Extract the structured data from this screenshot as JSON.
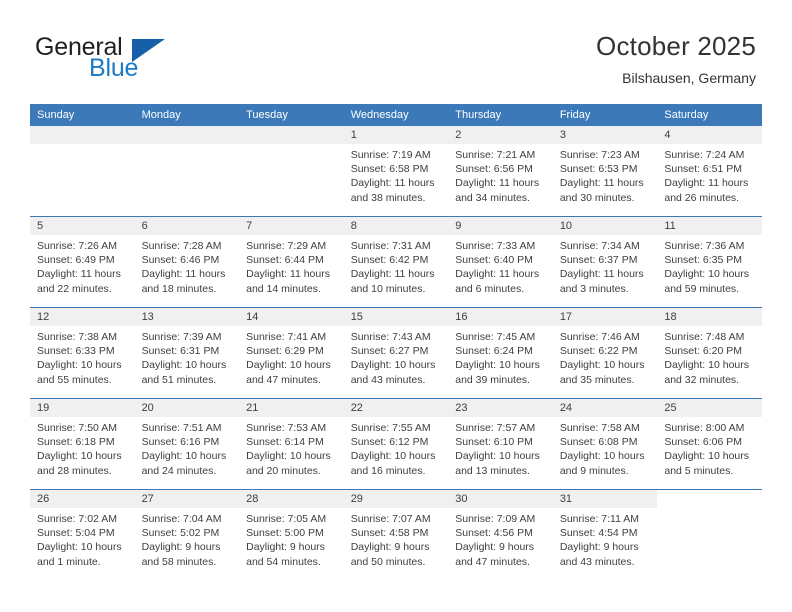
{
  "brand": {
    "name_primary": "General",
    "name_secondary": "Blue",
    "logo_icon": "triangle-logo-icon",
    "primary_color": "#231f20",
    "secondary_color": "#1b7ac4"
  },
  "header": {
    "title": "October 2025",
    "subtitle": "Bilshausen, Germany"
  },
  "theme": {
    "header_bg": "#3b79b8",
    "header_text": "#ffffff",
    "daynum_bg": "#f0f0f0",
    "body_text": "#3f3f3f",
    "page_bg": "#ffffff"
  },
  "weekdays": [
    "Sunday",
    "Monday",
    "Tuesday",
    "Wednesday",
    "Thursday",
    "Friday",
    "Saturday"
  ],
  "labels": {
    "sunrise_prefix": "Sunrise:",
    "sunset_prefix": "Sunset:",
    "daylight_prefix": "Daylight:"
  },
  "weeks": [
    [
      {
        "day": "",
        "empty": true,
        "blank": false,
        "line1": "",
        "line2": "",
        "line3": "",
        "line4": ""
      },
      {
        "day": "",
        "empty": true,
        "blank": false,
        "line1": "",
        "line2": "",
        "line3": "",
        "line4": ""
      },
      {
        "day": "",
        "empty": true,
        "blank": false,
        "line1": "",
        "line2": "",
        "line3": "",
        "line4": ""
      },
      {
        "day": "1",
        "empty": false,
        "blank": false,
        "line1": "Sunrise: 7:19 AM",
        "line2": "Sunset: 6:58 PM",
        "line3": "Daylight: 11 hours",
        "line4": "and 38 minutes."
      },
      {
        "day": "2",
        "empty": false,
        "blank": false,
        "line1": "Sunrise: 7:21 AM",
        "line2": "Sunset: 6:56 PM",
        "line3": "Daylight: 11 hours",
        "line4": "and 34 minutes."
      },
      {
        "day": "3",
        "empty": false,
        "blank": false,
        "line1": "Sunrise: 7:23 AM",
        "line2": "Sunset: 6:53 PM",
        "line3": "Daylight: 11 hours",
        "line4": "and 30 minutes."
      },
      {
        "day": "4",
        "empty": false,
        "blank": false,
        "line1": "Sunrise: 7:24 AM",
        "line2": "Sunset: 6:51 PM",
        "line3": "Daylight: 11 hours",
        "line4": "and 26 minutes."
      }
    ],
    [
      {
        "day": "5",
        "empty": false,
        "blank": false,
        "line1": "Sunrise: 7:26 AM",
        "line2": "Sunset: 6:49 PM",
        "line3": "Daylight: 11 hours",
        "line4": "and 22 minutes."
      },
      {
        "day": "6",
        "empty": false,
        "blank": false,
        "line1": "Sunrise: 7:28 AM",
        "line2": "Sunset: 6:46 PM",
        "line3": "Daylight: 11 hours",
        "line4": "and 18 minutes."
      },
      {
        "day": "7",
        "empty": false,
        "blank": false,
        "line1": "Sunrise: 7:29 AM",
        "line2": "Sunset: 6:44 PM",
        "line3": "Daylight: 11 hours",
        "line4": "and 14 minutes."
      },
      {
        "day": "8",
        "empty": false,
        "blank": false,
        "line1": "Sunrise: 7:31 AM",
        "line2": "Sunset: 6:42 PM",
        "line3": "Daylight: 11 hours",
        "line4": "and 10 minutes."
      },
      {
        "day": "9",
        "empty": false,
        "blank": false,
        "line1": "Sunrise: 7:33 AM",
        "line2": "Sunset: 6:40 PM",
        "line3": "Daylight: 11 hours",
        "line4": "and 6 minutes."
      },
      {
        "day": "10",
        "empty": false,
        "blank": false,
        "line1": "Sunrise: 7:34 AM",
        "line2": "Sunset: 6:37 PM",
        "line3": "Daylight: 11 hours",
        "line4": "and 3 minutes."
      },
      {
        "day": "11",
        "empty": false,
        "blank": false,
        "line1": "Sunrise: 7:36 AM",
        "line2": "Sunset: 6:35 PM",
        "line3": "Daylight: 10 hours",
        "line4": "and 59 minutes."
      }
    ],
    [
      {
        "day": "12",
        "empty": false,
        "blank": false,
        "line1": "Sunrise: 7:38 AM",
        "line2": "Sunset: 6:33 PM",
        "line3": "Daylight: 10 hours",
        "line4": "and 55 minutes."
      },
      {
        "day": "13",
        "empty": false,
        "blank": false,
        "line1": "Sunrise: 7:39 AM",
        "line2": "Sunset: 6:31 PM",
        "line3": "Daylight: 10 hours",
        "line4": "and 51 minutes."
      },
      {
        "day": "14",
        "empty": false,
        "blank": false,
        "line1": "Sunrise: 7:41 AM",
        "line2": "Sunset: 6:29 PM",
        "line3": "Daylight: 10 hours",
        "line4": "and 47 minutes."
      },
      {
        "day": "15",
        "empty": false,
        "blank": false,
        "line1": "Sunrise: 7:43 AM",
        "line2": "Sunset: 6:27 PM",
        "line3": "Daylight: 10 hours",
        "line4": "and 43 minutes."
      },
      {
        "day": "16",
        "empty": false,
        "blank": false,
        "line1": "Sunrise: 7:45 AM",
        "line2": "Sunset: 6:24 PM",
        "line3": "Daylight: 10 hours",
        "line4": "and 39 minutes."
      },
      {
        "day": "17",
        "empty": false,
        "blank": false,
        "line1": "Sunrise: 7:46 AM",
        "line2": "Sunset: 6:22 PM",
        "line3": "Daylight: 10 hours",
        "line4": "and 35 minutes."
      },
      {
        "day": "18",
        "empty": false,
        "blank": false,
        "line1": "Sunrise: 7:48 AM",
        "line2": "Sunset: 6:20 PM",
        "line3": "Daylight: 10 hours",
        "line4": "and 32 minutes."
      }
    ],
    [
      {
        "day": "19",
        "empty": false,
        "blank": false,
        "line1": "Sunrise: 7:50 AM",
        "line2": "Sunset: 6:18 PM",
        "line3": "Daylight: 10 hours",
        "line4": "and 28 minutes."
      },
      {
        "day": "20",
        "empty": false,
        "blank": false,
        "line1": "Sunrise: 7:51 AM",
        "line2": "Sunset: 6:16 PM",
        "line3": "Daylight: 10 hours",
        "line4": "and 24 minutes."
      },
      {
        "day": "21",
        "empty": false,
        "blank": false,
        "line1": "Sunrise: 7:53 AM",
        "line2": "Sunset: 6:14 PM",
        "line3": "Daylight: 10 hours",
        "line4": "and 20 minutes."
      },
      {
        "day": "22",
        "empty": false,
        "blank": false,
        "line1": "Sunrise: 7:55 AM",
        "line2": "Sunset: 6:12 PM",
        "line3": "Daylight: 10 hours",
        "line4": "and 16 minutes."
      },
      {
        "day": "23",
        "empty": false,
        "blank": false,
        "line1": "Sunrise: 7:57 AM",
        "line2": "Sunset: 6:10 PM",
        "line3": "Daylight: 10 hours",
        "line4": "and 13 minutes."
      },
      {
        "day": "24",
        "empty": false,
        "blank": false,
        "line1": "Sunrise: 7:58 AM",
        "line2": "Sunset: 6:08 PM",
        "line3": "Daylight: 10 hours",
        "line4": "and 9 minutes."
      },
      {
        "day": "25",
        "empty": false,
        "blank": false,
        "line1": "Sunrise: 8:00 AM",
        "line2": "Sunset: 6:06 PM",
        "line3": "Daylight: 10 hours",
        "line4": "and 5 minutes."
      }
    ],
    [
      {
        "day": "26",
        "empty": false,
        "blank": false,
        "line1": "Sunrise: 7:02 AM",
        "line2": "Sunset: 5:04 PM",
        "line3": "Daylight: 10 hours",
        "line4": "and 1 minute."
      },
      {
        "day": "27",
        "empty": false,
        "blank": false,
        "line1": "Sunrise: 7:04 AM",
        "line2": "Sunset: 5:02 PM",
        "line3": "Daylight: 9 hours",
        "line4": "and 58 minutes."
      },
      {
        "day": "28",
        "empty": false,
        "blank": false,
        "line1": "Sunrise: 7:05 AM",
        "line2": "Sunset: 5:00 PM",
        "line3": "Daylight: 9 hours",
        "line4": "and 54 minutes."
      },
      {
        "day": "29",
        "empty": false,
        "blank": false,
        "line1": "Sunrise: 7:07 AM",
        "line2": "Sunset: 4:58 PM",
        "line3": "Daylight: 9 hours",
        "line4": "and 50 minutes."
      },
      {
        "day": "30",
        "empty": false,
        "blank": false,
        "line1": "Sunrise: 7:09 AM",
        "line2": "Sunset: 4:56 PM",
        "line3": "Daylight: 9 hours",
        "line4": "and 47 minutes."
      },
      {
        "day": "31",
        "empty": false,
        "blank": false,
        "line1": "Sunrise: 7:11 AM",
        "line2": "Sunset: 4:54 PM",
        "line3": "Daylight: 9 hours",
        "line4": "and 43 minutes."
      },
      {
        "day": "",
        "empty": false,
        "blank": true,
        "line1": "",
        "line2": "",
        "line3": "",
        "line4": ""
      }
    ]
  ]
}
